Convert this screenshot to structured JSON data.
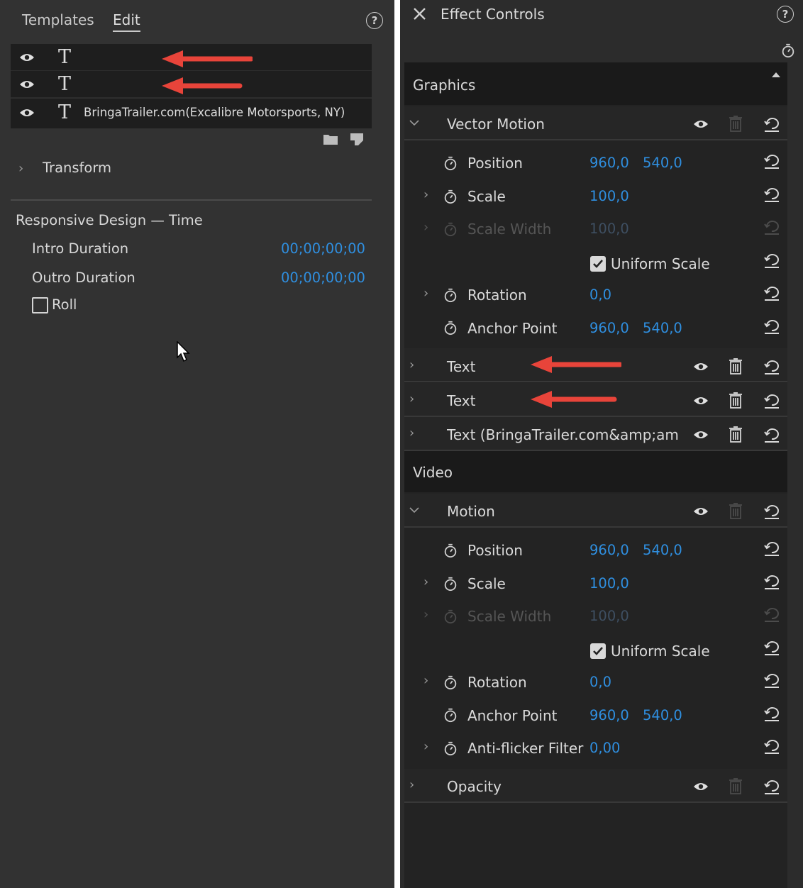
{
  "left_panel": {
    "tabs": [
      {
        "label": "Templates"
      },
      {
        "label": "Edit"
      }
    ],
    "layers": [
      {
        "name": ""
      },
      {
        "name": ""
      },
      {
        "name": "BringaTrailer.com(Excalibre Motorsports, NY)"
      }
    ],
    "transform_label": "Transform",
    "responsive": {
      "title": "Responsive Design — Time",
      "intro_label": "Intro Duration",
      "intro_value": "00;00;00;00",
      "outro_label": "Outro Duration",
      "outro_value": "00;00;00;00",
      "roll_label": "Roll"
    }
  },
  "effect_controls": {
    "title": "Effect Controls",
    "graphics": {
      "label": "Graphics",
      "vector_motion": {
        "label": "Vector Motion",
        "position_label": "Position",
        "position_x": "960,0",
        "position_y": "540,0",
        "scale_label": "Scale",
        "scale_value": "100,0",
        "scale_width_label": "Scale Width",
        "scale_width_value": "100,0",
        "uniform_label": "Uniform Scale",
        "rotation_label": "Rotation",
        "rotation_value": "0,0",
        "anchor_label": "Anchor Point",
        "anchor_x": "960,0",
        "anchor_y": "540,0"
      },
      "text_layers": [
        {
          "label": "Text"
        },
        {
          "label": "Text"
        },
        {
          "label": "Text (BringaTrailer.com&amp;amp;#..."
        }
      ]
    },
    "video": {
      "label": "Video",
      "motion": {
        "label": "Motion",
        "position_label": "Position",
        "position_x": "960,0",
        "position_y": "540,0",
        "scale_label": "Scale",
        "scale_value": "100,0",
        "scale_width_label": "Scale Width",
        "scale_width_value": "100,0",
        "uniform_label": "Uniform Scale",
        "rotation_label": "Rotation",
        "rotation_value": "0,0",
        "anchor_label": "Anchor Point",
        "anchor_x": "960,0",
        "anchor_y": "540,0",
        "antiflicker_label": "Anti-flicker Filter",
        "antiflicker_value": "0,00"
      },
      "opacity_label": "Opacity"
    }
  },
  "colors": {
    "accent_blue": "#2f8fe0",
    "arrow_red": "#e8443a"
  }
}
